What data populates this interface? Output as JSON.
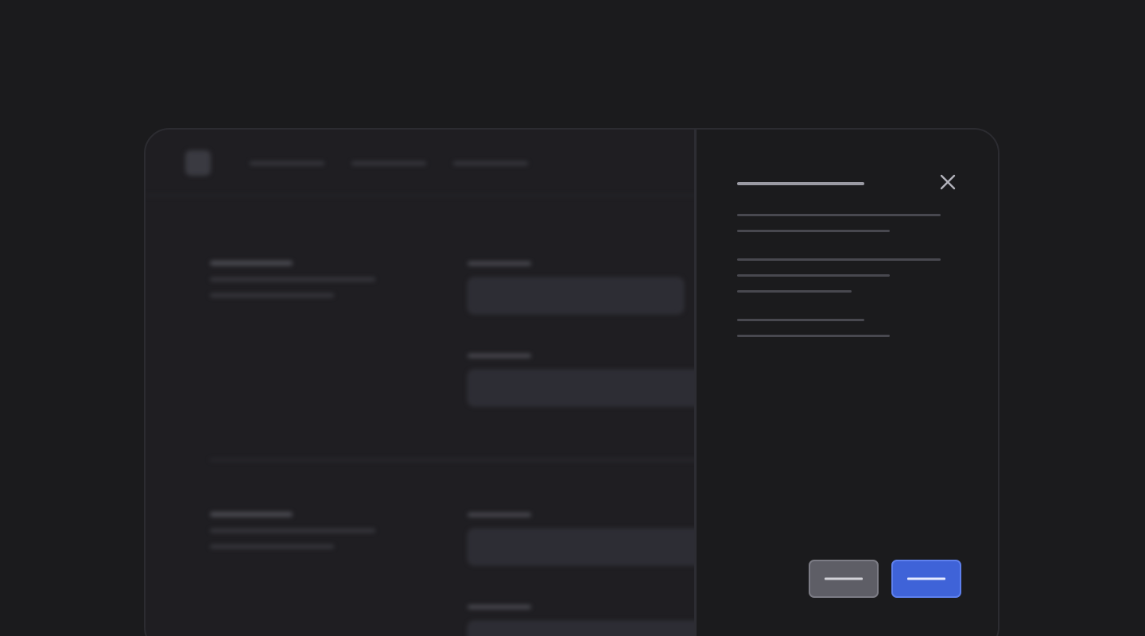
{
  "theme": {
    "page_background": "#1b1b1d",
    "window_background": "#1f1e22",
    "panel_background": "#1b1b1d",
    "accent": "#3f63d8",
    "secondary_button": "#5e5e66"
  },
  "background_app": {
    "logo_icon": "app-logo-icon",
    "nav_items": [
      "",
      "",
      ""
    ],
    "sections": [
      {
        "heading": "",
        "description_lines": [
          "",
          ""
        ],
        "fields": [
          {
            "label": "",
            "value": ""
          },
          {
            "label": "",
            "value": ""
          }
        ]
      },
      {
        "heading": "",
        "description_lines": [
          "",
          ""
        ],
        "fields": [
          {
            "label": "",
            "value": ""
          },
          {
            "label": "",
            "value": ""
          }
        ]
      }
    ]
  },
  "panel": {
    "title": "",
    "close_icon": "close-icon",
    "paragraphs": [
      [
        "",
        ""
      ],
      [
        "",
        "",
        ""
      ],
      [
        "",
        ""
      ]
    ],
    "cancel_label": "",
    "confirm_label": ""
  }
}
